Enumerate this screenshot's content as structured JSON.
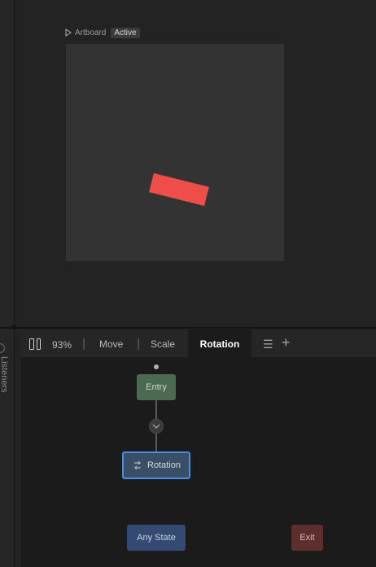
{
  "stage": {
    "artboard_label": "Artboard",
    "artboard_badge": "Active",
    "shape_color": "#ef4d4a",
    "shape_rotation_deg": 14
  },
  "sidebar": {
    "vertical_label": "Listeners"
  },
  "timeline": {
    "zoom": "93%",
    "tabs": [
      {
        "label": "Move",
        "active": false
      },
      {
        "label": "Scale",
        "active": false
      },
      {
        "label": "Rotation",
        "active": true
      }
    ],
    "icons": [
      "pause-icon",
      "menu-icon",
      "add-icon"
    ]
  },
  "graph": {
    "entry_label": "Entry",
    "rotation_label": "Rotation",
    "any_state_label": "Any State",
    "exit_label": "Exit"
  },
  "colors": {
    "entry": "#4c6a52",
    "rotation_border": "#4a8ce8",
    "any_state": "#344a73",
    "exit": "#5c2e2e"
  }
}
